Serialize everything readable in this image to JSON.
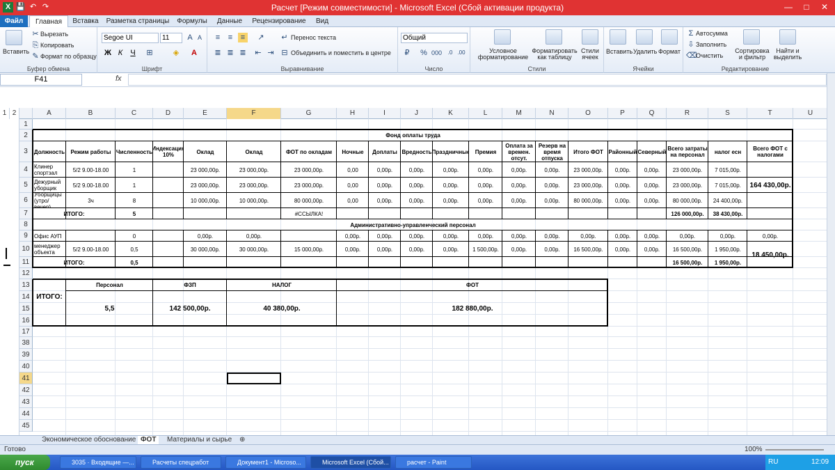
{
  "window": {
    "title": "Расчет  [Режим совместимости]  -  Microsoft Excel (Сбой активации продукта)",
    "qat_app": "X",
    "qat_save": "💾",
    "qat_undo": "↶",
    "qat_redo": "↷",
    "min": "—",
    "max": "□",
    "close": "✕"
  },
  "tabs": [
    "Файл",
    "Главная",
    "Вставка",
    "Разметка страницы",
    "Формулы",
    "Данные",
    "Рецензирование",
    "Вид"
  ],
  "ribbon": {
    "clipboard": {
      "paste": "Вставить",
      "cut": "Вырезать",
      "copy": "Копировать",
      "format": "Формат по образцу",
      "label": "Буфер обмена"
    },
    "font": {
      "name": "Segoe UI",
      "size": "11",
      "bold": "Ж",
      "italic": "К",
      "underline": "Ч",
      "label": "Шрифт"
    },
    "align": {
      "wrap": "Перенос текста",
      "merge": "Объединить и поместить в центре",
      "label": "Выравнивание"
    },
    "number": {
      "format": "Общий",
      "label": "Число"
    },
    "styles": {
      "cond": "Условное форматирование",
      "table": "Форматировать как таблицу",
      "cell": "Стили ячеек",
      "label": "Стили"
    },
    "cells": {
      "insert": "Вставить",
      "delete": "Удалить",
      "format": "Формат",
      "label": "Ячейки"
    },
    "editing": {
      "autosum": "Автосумма",
      "fill": "Заполнить",
      "clear": "Очистить",
      "sort": "Сортировка и фильтр",
      "find": "Найти и выделить",
      "label": "Редактирование"
    }
  },
  "formula": {
    "namebox": "F41",
    "fx": "fx",
    "value": ""
  },
  "outline_levels": [
    "1",
    "2"
  ],
  "columns": [
    "A",
    "B",
    "C",
    "D",
    "E",
    "F",
    "G",
    "H",
    "I",
    "J",
    "K",
    "L",
    "M",
    "N",
    "O",
    "P",
    "Q",
    "R",
    "S",
    "T",
    "U"
  ],
  "rows": [
    "1",
    "2",
    "3",
    "4",
    "5",
    "6",
    "7",
    "8",
    "9",
    "10",
    "11",
    "12",
    "13",
    "14",
    "15",
    "16",
    "17",
    "38",
    "39",
    "40",
    "41",
    "42",
    "43",
    "44",
    "45"
  ],
  "sheet": {
    "title": "Фонд оплаты труда",
    "headers": [
      "Должность",
      "Режим работы",
      "Численность",
      "Индексация 10%",
      "Оклад",
      "Оклад",
      "ФОТ по окладам",
      "Ночные",
      "Доплаты",
      "Вредность",
      "Праздничные",
      "Премия",
      "Оплата за времен. отсут.",
      "Резерв на время отпуска",
      "Итого ФОТ",
      "Районный",
      "Северный",
      "Всего затраты на персонал",
      "налог есн",
      "Всего ФОТ с налогами"
    ],
    "r4": [
      "Клинер спортзал",
      "5/2 9.00-18.00",
      "1",
      "",
      "23 000,00р.",
      "23 000,00р.",
      "23 000,00р.",
      "0,00",
      "0,00р.",
      "0,00р.",
      "0,00р.",
      "0,00р.",
      "0,00р.",
      "0,00р.",
      "23 000,00р.",
      "0,00р.",
      "0,00р.",
      "23 000,00р.",
      "7 015,00р."
    ],
    "r5": [
      "Дежурный уборщик",
      "5/2 9.00-18.00",
      "1",
      "",
      "23 000,00р.",
      "23 000,00р.",
      "23 000,00р.",
      "0,00",
      "0,00р.",
      "0,00р.",
      "0,00р.",
      "0,00р.",
      "0,00р.",
      "0,00р.",
      "23 000,00р.",
      "0,00р.",
      "0,00р.",
      "23 000,00р.",
      "7 015,00р."
    ],
    "r6": [
      "Уборщицы (утро/вечер)",
      "3ч",
      "8",
      "",
      "10 000,00р.",
      "10 000,00р.",
      "80 000,00р.",
      "0,00",
      "0,00р.",
      "0,00р.",
      "0,00р.",
      "0,00р.",
      "0,00р.",
      "0,00р.",
      "80 000,00р.",
      "0,00р.",
      "0,00р.",
      "80 000,00р.",
      "24 400,00р."
    ],
    "t_total1": "164 430,00р.",
    "r7": {
      "label": "ИТОГО:",
      "count": "5",
      "ref": "#ССЫЛКА!",
      "total": "126 000,00р.",
      "tax": "38 430,00р."
    },
    "r8": "Административно-управленческий персонал",
    "r9": [
      "Офис  АУП",
      "",
      "0",
      "",
      "0,00р.",
      "0,00р.",
      "",
      "0,00р.",
      "0,00р.",
      "0,00р.",
      "0,00р.",
      "0,00р.",
      "0,00р.",
      "0,00р.",
      "0,00р.",
      "0,00р.",
      "0,00р.",
      "0,00р.",
      "0,00р.",
      "0,00р."
    ],
    "r10": [
      "менеджер объекта",
      "5/2 9.00-18.00",
      "0,5",
      "",
      "30 000,00р.",
      "30 000,00р.",
      "15 000,00р.",
      "0,00р.",
      "0,00р.",
      "0,00р.",
      "0,00р.",
      "1 500,00р.",
      "0,00р.",
      "0,00р.",
      "16 500,00р.",
      "0,00р.",
      "0,00р.",
      "16 500,00р.",
      "1 950,00р."
    ],
    "t_total2": "18 450,00р.",
    "r11": {
      "label": "ИТОГО:",
      "count": "0,5",
      "total": "16 500,00р.",
      "tax": "1 950,00р."
    },
    "summary": {
      "label": "ИТОГО:",
      "h_personal": "Персонал",
      "h_fzp": "ФЗП",
      "h_tax": "НАЛОГ",
      "h_fot": "ФОТ",
      "v_personal": "5,5",
      "v_fzp": "142 500,00р.",
      "v_tax": "40 380,00р.",
      "v_fot": "182 880,00р."
    }
  },
  "sheet_tabs": [
    "Экономическое обоснование",
    "ФОТ",
    "Материалы и сырье"
  ],
  "status": {
    "ready": "Готово",
    "zoom": "100%"
  },
  "taskbar": {
    "start": "пуск",
    "items": [
      "3035 · Входящие —...",
      "Расчеты спецработ",
      "Документ1 - Microso...",
      "Microsoft Excel (Сбой...",
      "расчет - Paint"
    ],
    "lang": "RU",
    "time": "12:09"
  }
}
